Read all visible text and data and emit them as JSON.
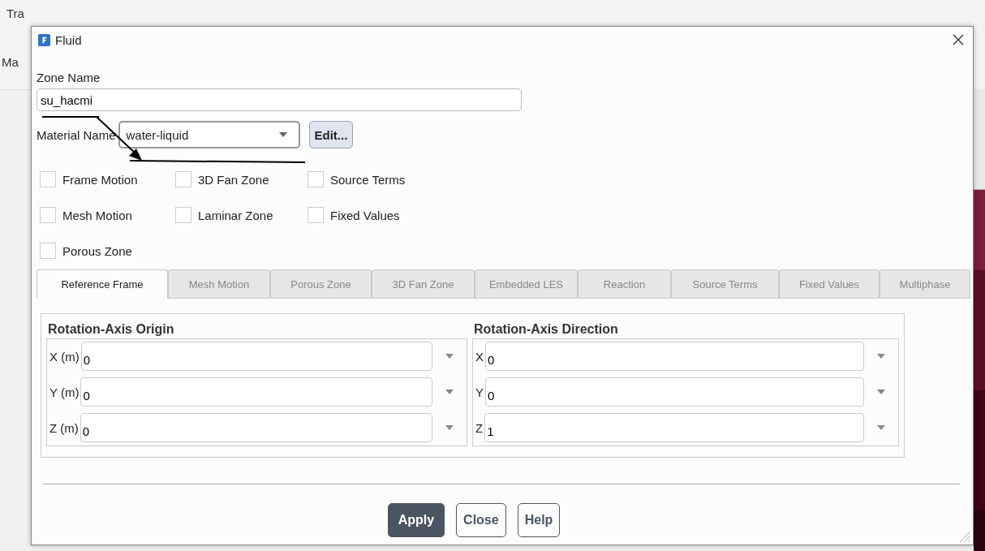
{
  "background": {
    "menu_items": [
      "Tra",
      "Ma"
    ]
  },
  "dialog": {
    "title": "Fluid",
    "zone_name": {
      "label": "Zone Name",
      "value": "su_hacmi"
    },
    "material": {
      "label": "Material Name",
      "value": "water-liquid",
      "button": "Edit..."
    },
    "options": [
      {
        "label": "Frame Motion",
        "checked": false
      },
      {
        "label": "3D Fan Zone",
        "checked": false
      },
      {
        "label": "Source Terms",
        "checked": false
      },
      {
        "label": "Mesh Motion",
        "checked": false
      },
      {
        "label": "Laminar Zone",
        "checked": false
      },
      {
        "label": "Fixed Values",
        "checked": false
      },
      {
        "label": "Porous Zone",
        "checked": false
      }
    ],
    "tabs": [
      {
        "label": "Reference Frame",
        "selected": true
      },
      {
        "label": "Mesh Motion",
        "selected": false
      },
      {
        "label": "Porous Zone",
        "selected": false
      },
      {
        "label": "3D Fan Zone",
        "selected": false
      },
      {
        "label": "Embedded LES",
        "selected": false
      },
      {
        "label": "Reaction",
        "selected": false
      },
      {
        "label": "Source Terms",
        "selected": false
      },
      {
        "label": "Fixed Values",
        "selected": false
      },
      {
        "label": "Multiphase",
        "selected": false
      }
    ],
    "groups": [
      {
        "title": "Rotation-Axis Origin",
        "fields": [
          {
            "label": "X (m)",
            "value": "0"
          },
          {
            "label": "Y (m)",
            "value": "0"
          },
          {
            "label": "Z (m)",
            "value": "0"
          }
        ]
      },
      {
        "title": "Rotation-Axis Direction",
        "fields": [
          {
            "label": "X",
            "value": "0"
          },
          {
            "label": "Y",
            "value": "0"
          },
          {
            "label": "Z",
            "value": "1"
          }
        ]
      }
    ],
    "buttons": [
      {
        "label": "Apply",
        "kind": "primary"
      },
      {
        "label": "Close",
        "kind": "normal"
      },
      {
        "label": "Help",
        "kind": "normal"
      }
    ]
  }
}
